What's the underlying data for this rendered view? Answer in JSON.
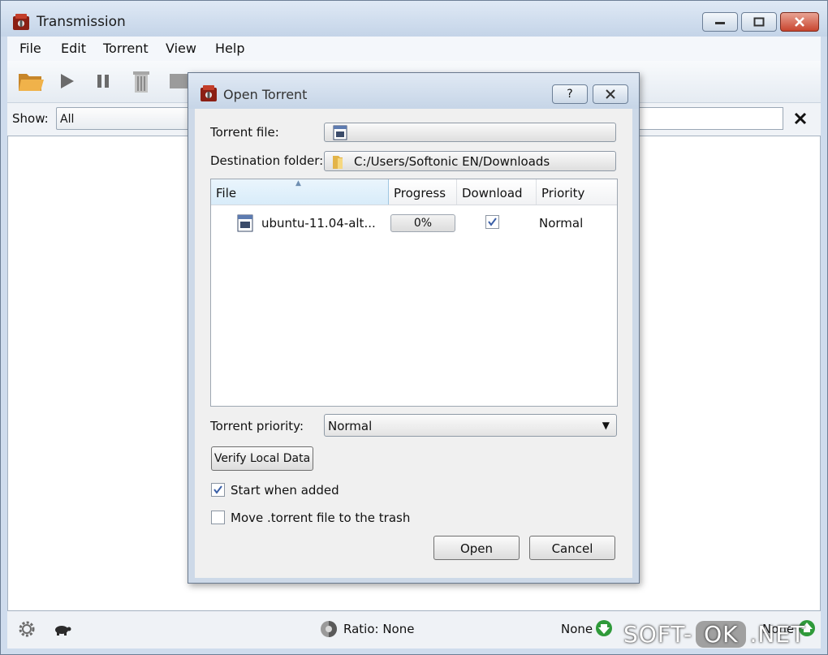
{
  "window": {
    "title": "Transmission",
    "icons": {
      "app": "transmission-app-icon",
      "minimize": "minimize-icon",
      "maximize": "maximize-icon",
      "close": "close-icon"
    }
  },
  "menu": [
    "File",
    "Edit",
    "Torrent",
    "View",
    "Help"
  ],
  "toolbar": {
    "icons": [
      "open-folder-icon",
      "start-play-icon",
      "pause-icon",
      "remove-icon",
      "properties-icon"
    ]
  },
  "filter": {
    "show_label": "Show:",
    "show_value": "All",
    "clear_icon": "✕"
  },
  "statusbar": {
    "ratio": "Ratio: None",
    "download": "None",
    "upload": "None"
  },
  "dialog": {
    "title": "Open Torrent",
    "help_label": "?",
    "torrent_file_label": "Torrent file:",
    "torrent_file_value": "",
    "destination_label": "Destination folder:",
    "destination_value": "C:/Users/Softonic EN/Downloads",
    "columns": [
      "File",
      "Progress",
      "Download",
      "Priority"
    ],
    "files": [
      {
        "name": "ubuntu-11.04-alt...",
        "progress": "0%",
        "download": true,
        "priority": "Normal"
      }
    ],
    "torrent_priority_label": "Torrent priority:",
    "torrent_priority_value": "Normal",
    "verify_label": "Verify Local Data",
    "start_when_added_label": "Start when added",
    "start_when_added": true,
    "move_to_trash_label": "Move .torrent file to the trash",
    "move_to_trash": false,
    "open_label": "Open",
    "cancel_label": "Cancel"
  },
  "watermark": {
    "left": "SOFT-",
    "mid": "OK",
    "right": ".NET"
  },
  "colors": {
    "accent": "#cdd9e8",
    "download_green": "#2f9a3a",
    "close_red": "#c8452f"
  }
}
